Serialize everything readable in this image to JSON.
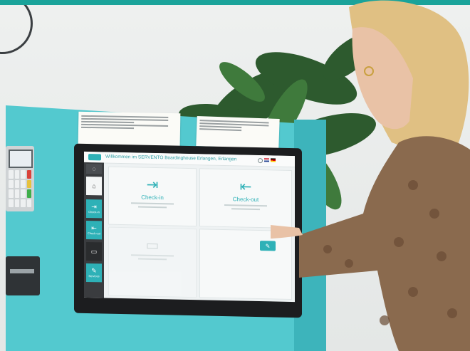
{
  "colors": {
    "top_bar": "#1aa39a",
    "kiosk": "#53c9cf",
    "accent": "#2eb1b7",
    "screen_bg": "#eef2f3",
    "sidebar": "#3a3c3f"
  },
  "screen": {
    "welcome": "Willkommen im SERVENTO Boardinghouse Erlangen, Erlangen",
    "sidebar": [
      {
        "label": "",
        "icon": "language-icon"
      },
      {
        "label": "",
        "icon": "home-icon"
      },
      {
        "label": "Check-in",
        "icon": "door-enter-icon"
      },
      {
        "label": "Check-out",
        "icon": "door-exit-icon"
      },
      {
        "label": "",
        "icon": "bed-icon"
      },
      {
        "label": "Services",
        "icon": "services-icon"
      }
    ],
    "tiles": {
      "checkin": "Check-in",
      "checkout": "Check-out",
      "rooms": "",
      "services": ""
    }
  }
}
